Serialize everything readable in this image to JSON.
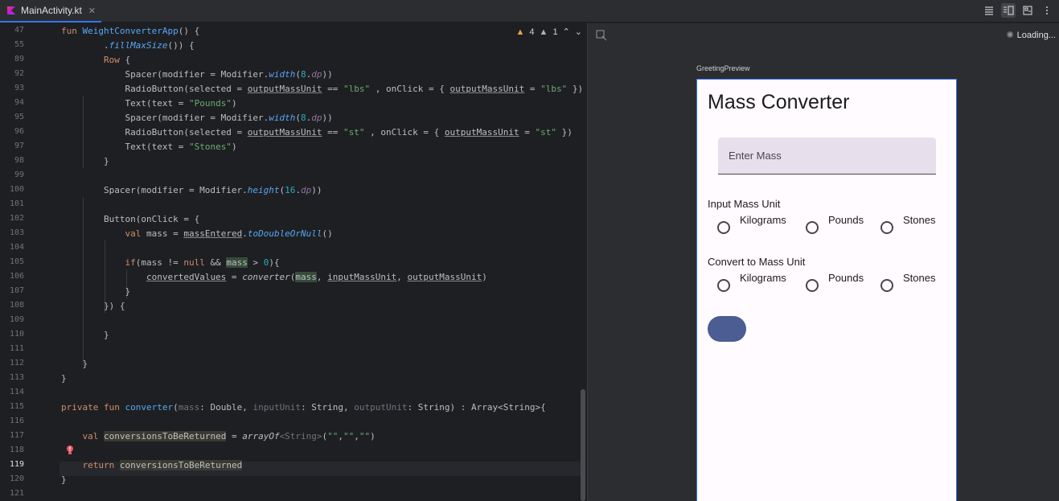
{
  "tab": {
    "name": "MainActivity.kt",
    "close": "✕"
  },
  "warnings": {
    "warn_count": "4",
    "weak_count": "1"
  },
  "editor": {
    "line_numbers": [
      "47",
      "55",
      "89",
      "92",
      "93",
      "94",
      "95",
      "96",
      "97",
      "98",
      "99",
      "100",
      "101",
      "102",
      "103",
      "104",
      "105",
      "106",
      "107",
      "108",
      "109",
      "110",
      "111",
      "112",
      "113",
      "114",
      "115",
      "116",
      "117",
      "118",
      "119",
      "120",
      "121"
    ],
    "current_line": "119"
  },
  "preview": {
    "loading": "Loading...",
    "label": "GreetingPreview",
    "app": {
      "title": "Mass Converter",
      "input_placeholder": "Enter Mass",
      "input_unit_label": "Input Mass Unit",
      "output_unit_label": "Convert to Mass Unit",
      "options": [
        "Kilograms",
        "Pounds",
        "Stones"
      ]
    }
  },
  "colors": {
    "accent": "#3574f0",
    "button": "#4b5d92",
    "phone_bg": "#fffbfe"
  }
}
